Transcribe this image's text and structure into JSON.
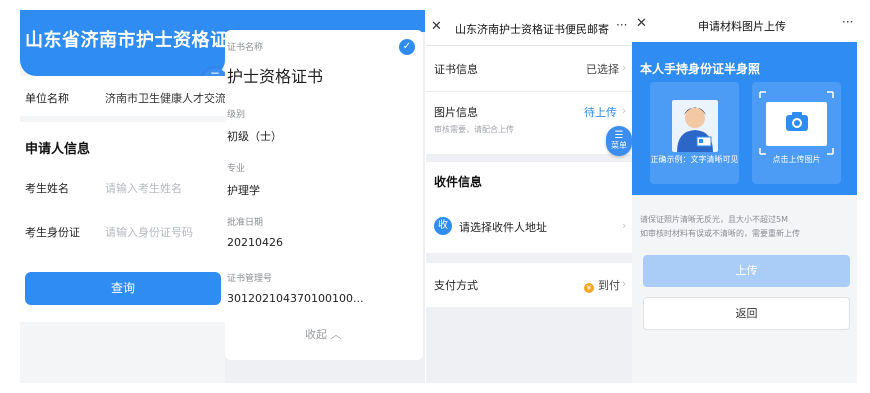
{
  "panel1": {
    "header_title": "山东省济南市护士资格证书",
    "menu_label": "菜单",
    "unit_label": "单位名称",
    "unit_value": "济南市卫生健康人才交流",
    "section_title": "申请人信息",
    "name_label": "考生姓名",
    "name_placeholder": "请输入考生姓名",
    "id_label": "考生身份证",
    "id_placeholder": "请输入身份证号码",
    "query_button": "查询"
  },
  "panel2": {
    "cert_name_label": "证书名称",
    "cert_name_value": "护士资格证书",
    "level_label": "级别",
    "level_value": "初级（士）",
    "major_label": "专业",
    "major_value": "护理学",
    "approval_date_label": "批准日期",
    "approval_date_value": "20210426",
    "cert_no_label": "证书管理号",
    "cert_no_value": "3012021043701001​00...",
    "collapse_label": "收起"
  },
  "panel3": {
    "header_title": "山东济南护士资格证书便民邮寄",
    "cert_info_label": "证书信息",
    "cert_info_value": "已选择",
    "photo_info_label": "图片信息",
    "photo_info_sub": "审核需要，请配合上传",
    "photo_info_value": "待上传",
    "menu_label": "菜单",
    "receive_title": "收件信息",
    "receive_badge": "收",
    "receive_address": "请选择收件人地址",
    "pay_label": "支付方式",
    "pay_value": "到付",
    "pay_coin": "¥"
  },
  "panel4": {
    "header_title": "申请材料图片上传",
    "section_title": "本人手持身份证半身照",
    "example_caption": "正确示例：文字清晰可见",
    "upload_caption": "点击上传图片",
    "hint1": "请保证照片清晰无反光，且大小不超过5M",
    "hint2": "如审核时材料有误或不清晰的，需要重新上传",
    "upload_button": "上传",
    "back_button": "返回"
  },
  "colors": {
    "primary": "#2f8cf3",
    "accent_orange": "#f5a623"
  }
}
